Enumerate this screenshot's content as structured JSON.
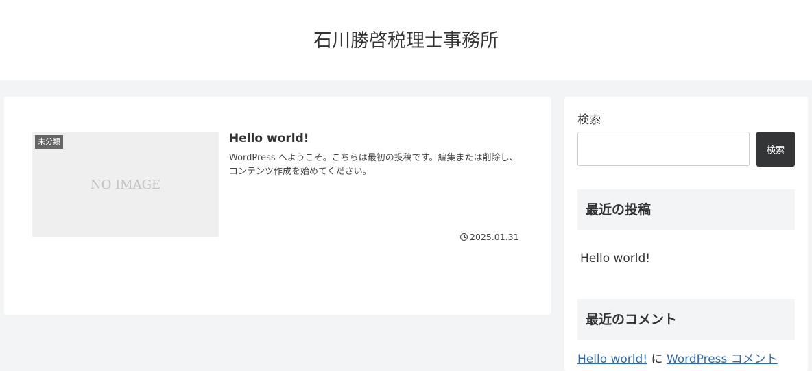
{
  "header": {
    "site_title": "石川勝啓税理士事務所"
  },
  "post": {
    "category": "未分類",
    "thumbnail_text": "NO IMAGE",
    "title": "Hello world!",
    "excerpt": "WordPress へようこそ。こちらは最初の投稿です。編集または削除し、コンテンツ作成を始めてください。",
    "date": "2025.01.31",
    "date_icon": "clock-icon"
  },
  "sidebar": {
    "search": {
      "label": "検索",
      "input_value": "",
      "button_label": "検索"
    },
    "recent_posts": {
      "heading": "最近の投稿",
      "items": [
        "Hello world!"
      ]
    },
    "recent_comments": {
      "heading": "最近のコメント",
      "post_link": "Hello world!",
      "connector": " に ",
      "author_link": "WordPress コメント"
    }
  },
  "colors": {
    "page_background": "#f3f4f6",
    "card_background": "#ffffff",
    "search_button": "#333537",
    "link": "#2e6bb0",
    "category_badge": "#666666"
  }
}
